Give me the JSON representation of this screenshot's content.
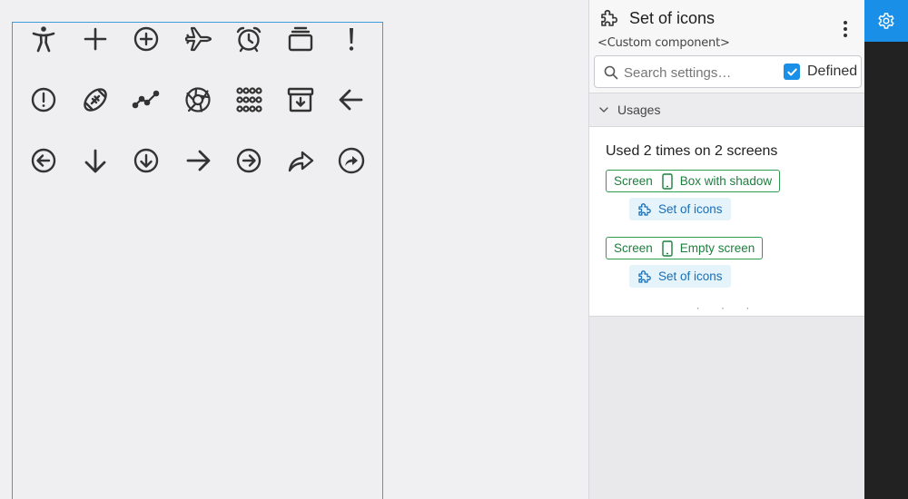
{
  "canvas": {
    "icons": [
      [
        "accessibility-icon",
        "plus-icon",
        "add-circle-icon",
        "airplane-icon",
        "alarm-clock-icon",
        "albums-icon",
        "alert-icon"
      ],
      [
        "alert-circle-icon",
        "american-football-icon",
        "analytics-icon",
        "aperture-icon",
        "apps-grid-icon",
        "archive-icon",
        "arrow-back-icon"
      ],
      [
        "arrow-back-circle-icon",
        "arrow-down-icon",
        "arrow-down-circle-icon",
        "arrow-forward-icon",
        "arrow-forward-circle-icon",
        "arrow-redo-icon",
        "arrow-redo-circle-icon"
      ]
    ],
    "frame_color": "#3d9ddb",
    "icon_color": "#333333"
  },
  "panel": {
    "title": "Set of icons",
    "subtitle": "<Custom component>",
    "search": {
      "placeholder": "Search settings…",
      "value": ""
    },
    "defined": {
      "label": "Defined",
      "checked": true
    },
    "usages": {
      "section_title": "Usages",
      "summary": "Used 2 times on 2 screens",
      "entries": [
        {
          "screen_label": "Screen",
          "screen_name": "Box with shadow",
          "component_name": "Set of icons"
        },
        {
          "screen_label": "Screen",
          "screen_name": "Empty screen",
          "component_name": "Set of icons"
        }
      ],
      "more": "· · ·"
    }
  },
  "colors": {
    "accent": "#1a8fe8",
    "screen_chip": "#2e9c52",
    "component_chip_text": "#1a6fb5",
    "component_chip_bg": "#e5f3fb",
    "dark_strip": "#222222"
  }
}
